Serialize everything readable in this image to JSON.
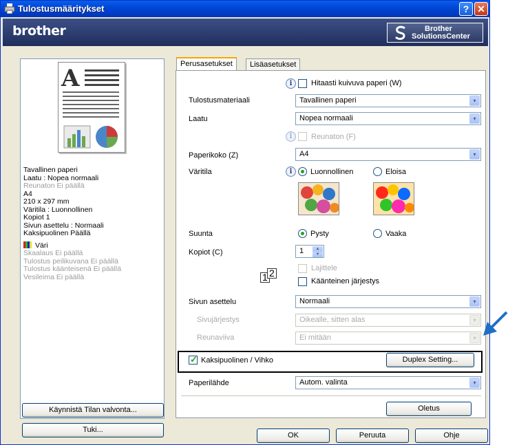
{
  "window": {
    "title": "Tulostusmääritykset",
    "help_glyph": "?",
    "close_glyph": "✕"
  },
  "brand": {
    "logo": "brother",
    "solutions_line1": "Brother",
    "solutions_line2": "SolutionsCenter"
  },
  "summary": {
    "lines": [
      {
        "text": "Tavallinen paperi",
        "dim": false
      },
      {
        "text": "Laatu : Nopea normaali",
        "dim": false
      },
      {
        "text": "Reunaton  Ei päällä",
        "dim": true
      },
      {
        "text": "A4",
        "dim": false
      },
      {
        "text": "210 x 297 mm",
        "dim": false
      },
      {
        "text": "Väritila : Luonnollinen",
        "dim": false
      },
      {
        "text": "Kopiot  1",
        "dim": false
      },
      {
        "text": "Sivun asettelu : Normaali",
        "dim": false
      },
      {
        "text": "Kaksipuolinen Päällä",
        "dim": false
      }
    ],
    "color_label": "Väri",
    "extra_lines": [
      "Skaalaus Ei päällä",
      "Tulostus peilikuvana Ei päällä",
      "Tulostus käänteisenä Ei päällä",
      "Vesileima Ei päällä"
    ]
  },
  "left_buttons": {
    "status_monitor": "Käynnistä Tilan valvonta...",
    "support": "Tuki..."
  },
  "tabs": [
    {
      "label": "Perusasetukset",
      "active": true
    },
    {
      "label": "Lisäasetukset",
      "active": false
    }
  ],
  "basic": {
    "slow_dry_label": "Hitaasti kuivuva paperi (W)",
    "media_label": "Tulostusmateriaali",
    "media_value": "Tavallinen paperi",
    "quality_label": "Laatu",
    "quality_value": "Nopea normaali",
    "borderless_label": "Reunaton (F)",
    "paper_size_label": "Paperikoko (Z)",
    "paper_size_value": "A4",
    "color_mode_label": "Väritila",
    "color_natural": "Luonnollinen",
    "color_vivid": "Eloisa",
    "orientation_label": "Suunta",
    "portrait": "Pysty",
    "landscape": "Vaaka",
    "copies_label": "Kopiot (C)",
    "copies_value": "1",
    "collate_label": "Lajittele",
    "reverse_order_label": "Käänteinen järjestys",
    "collate_icon_text": "1",
    "collate_icon_text2": "2",
    "layout_label": "Sivun asettelu",
    "layout_value": "Normaali",
    "page_order_label": "Sivujärjestys",
    "page_order_value": "Oikealle, sitten alas",
    "border_line_label": "Reunaviiva",
    "border_line_value": "Ei mitään",
    "duplex_label": "Kaksipuolinen / Vihko",
    "duplex_button": "Duplex Setting...",
    "paper_source_label": "Paperilähde",
    "paper_source_value": "Autom. valinta",
    "default_button": "Oletus"
  },
  "footer": {
    "ok": "OK",
    "cancel": "Peruuta",
    "help": "Ohje"
  },
  "icons": {
    "arrow": "▾",
    "spin_up": "▲",
    "spin_down": "▼",
    "info": "i"
  },
  "colors": {
    "title_blue": "#0047d8",
    "brand_navy": "#2a3a6c",
    "pointer_blue": "#1f6fc4",
    "highlight": "#000000"
  }
}
